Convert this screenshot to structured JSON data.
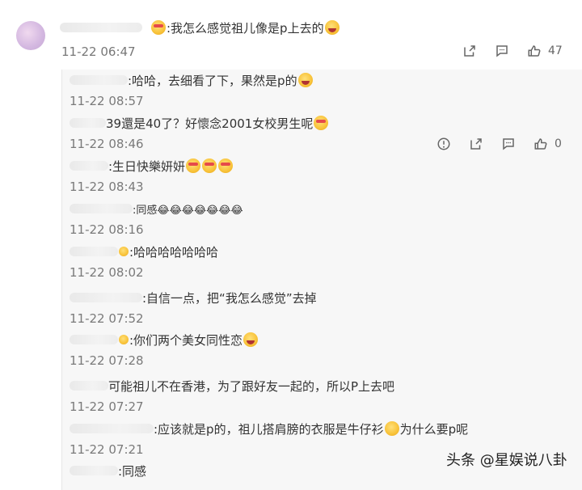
{
  "comment": {
    "text": ":我怎么感觉祖儿像是p上去的",
    "time": "11-22 06:47",
    "like_count": "47"
  },
  "replies": [
    {
      "text": ":哈哈，去细看了下，果然是p的",
      "time": "11-22 08:57"
    },
    {
      "text": "39還是40了？好懷念2001女校男生呢",
      "time": "11-22 08:46",
      "like_count": "0"
    },
    {
      "text": ":生日快樂妍妍",
      "time": "11-22 08:43"
    },
    {
      "text": ":同感😂😂😂😂😂😂😂",
      "time": "11-22 08:16"
    },
    {
      "text": ":哈哈哈哈哈哈哈",
      "time": "11-22 08:02"
    },
    {
      "text": ":自信一点，把“我怎么感觉”去掉",
      "time": "11-22 07:52"
    },
    {
      "text": ":你们两个美女同性恋",
      "time": "11-22 07:28"
    },
    {
      "text": "可能祖儿不在香港，为了跟好友一起的，所以P上去吧",
      "time": "11-22 07:27"
    },
    {
      "text": ":应该就是p的，祖儿搭肩膀的衣服是牛仔衫",
      "text2": "为什么要p呢",
      "time": "11-22 07:21"
    },
    {
      "text": ":同感",
      "time": ""
    }
  ],
  "watermark": "头条 @星娱说八卦",
  "colors": {
    "reply_bg": "#f7f7f7",
    "time": "#7a7a7a",
    "emoji": "#f8c238"
  }
}
